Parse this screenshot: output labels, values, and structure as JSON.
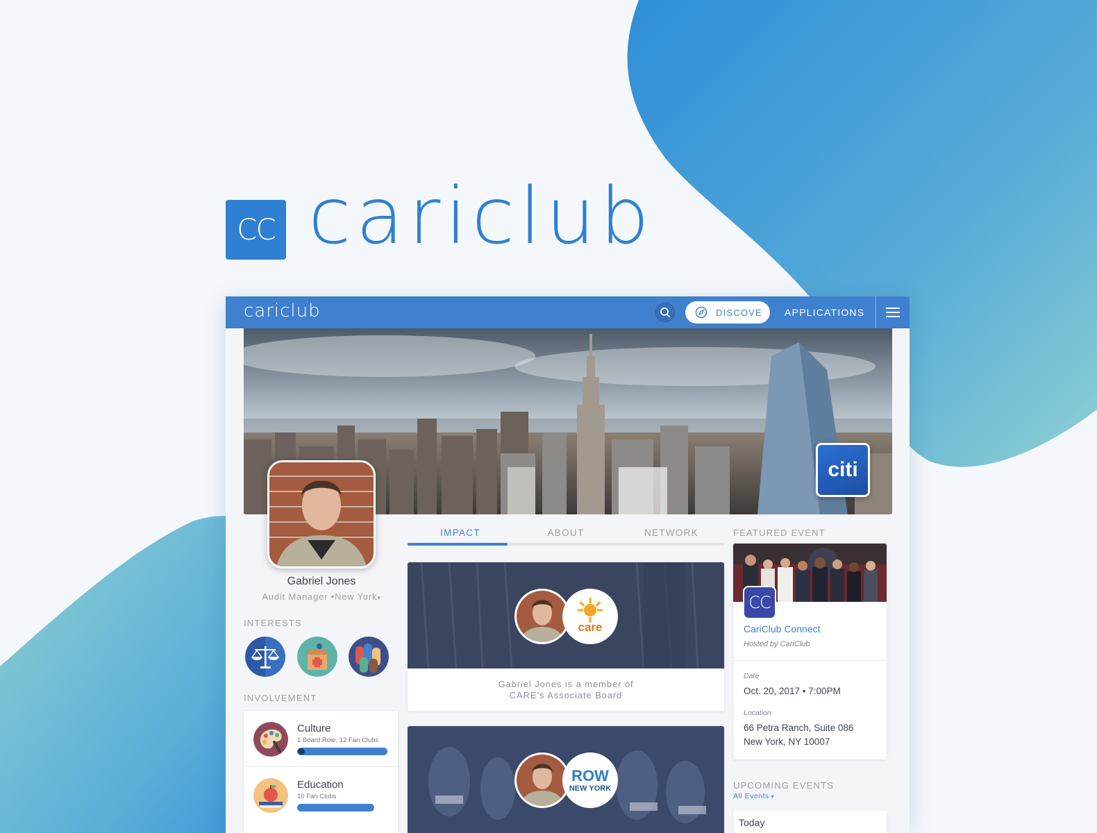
{
  "brand": {
    "logo_mark": "CC",
    "wordmark": "cariclub"
  },
  "navbar": {
    "brand": "cariclub",
    "search_icon": "search-icon",
    "discover_label": "DISCOVE",
    "discover_icon": "compass-icon",
    "applications_label": "APPLICATIONS",
    "menu_icon": "hamburger-menu-icon"
  },
  "cover": {
    "company_logo": "citi"
  },
  "profile": {
    "name": "Gabriel Jones",
    "subtitle": "Audit Manager •New York"
  },
  "interests": {
    "label": "INTERESTS",
    "items": [
      "justice-scales-icon",
      "medical-donation-box-icon",
      "hands-together-icon"
    ]
  },
  "involvement": {
    "label": "INVOLVEMENT",
    "items": [
      {
        "title": "Culture",
        "desc": "1 Board Role, 12 Fan Clubs",
        "icon": "palette-icon"
      },
      {
        "title": "Education",
        "desc": "10 Fan Clubs",
        "icon": "apple-books-icon"
      }
    ]
  },
  "tabs": [
    {
      "label": "IMPACT",
      "active": true
    },
    {
      "label": "ABOUT",
      "active": false
    },
    {
      "label": "NETWORK",
      "active": false
    }
  ],
  "feed": [
    {
      "org_logo": "care",
      "caption_line1": "Gabriel Jones is a member of",
      "caption_line2": "CARE’s Associate Board"
    },
    {
      "org_logo_line1": "ROW",
      "org_logo_line2": "NEW YORK"
    }
  ],
  "featured_event": {
    "label": "FEATURED EVENT",
    "logo_mark": "CC",
    "title": "CariClub Connect",
    "host": "Hosted by CariClub",
    "date_label": "Date",
    "date_value": "Oct. 20, 2017 • 7:00PM",
    "location_label": "Location",
    "location_line1": "66 Petra Ranch, Suite 086",
    "location_line2": "New York, NY 10007"
  },
  "upcoming_events": {
    "label": "UPCOMING EVENTS",
    "filter": "All Events",
    "first_group": "Today"
  },
  "colors": {
    "brand_blue": "#3f80cf",
    "logo_blue": "#2f80d3",
    "blob_blue": "#3a96d8",
    "blob_teal": "#86ccd0"
  }
}
